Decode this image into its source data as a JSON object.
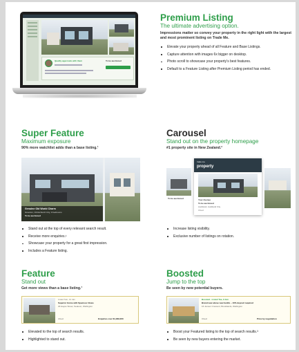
{
  "premium": {
    "title": "Premium Listing",
    "subtitle": "The ultimate advertising option.",
    "lead": "Impressions matter so convey your property in the right light with the largest and most prominent listing on Trade Me.",
    "bullets": [
      "Elevate your property ahead of all Feature and Base Listings.",
      "Capture attention with images 6x bigger on desktop.",
      "Photo scroll to showcase your property's best features.",
      "Default to a Feature Listing after Premium Listing period has ended."
    ],
    "screen": {
      "agent_text": "Quality approvals with them",
      "price_label": "To be auctioned"
    }
  },
  "super": {
    "title": "Super Feature",
    "subtitle": "Maximum exposure",
    "lead": "90% more watchlist adds than a base listing.¹",
    "photo_caption_title": "Genuine Old World Charm",
    "photo_caption_sub": "Greerton, Christchurch City, 3 bedrooms",
    "photo_caption_price": "To be auctioned",
    "bullets": [
      "Stand out at the top of every relevant search result.",
      "Receive more enquiries.¹",
      "Showcase your property for a great first impression.",
      "Includes a Feature listing."
    ]
  },
  "carousel": {
    "title": "Carousel",
    "subtitle": "Stand out on the property homepage",
    "lead": "#1 property site in New Zealand.²",
    "logo_small": "trade me",
    "logo_big": "property",
    "card_title": "Your Avenue",
    "card_price": "To be auctioned",
    "card_loc": "Auckland, Auckland City",
    "card_meta": "3 bed",
    "left_price": "To be auctioned",
    "bullets": [
      "Increase listing visibility.",
      "Exclusive number of listings on rotation."
    ]
  },
  "feature": {
    "title": "Feature",
    "subtitle": "Stand out",
    "lead": "Get more views than a base listing.¹",
    "card_head": "Listed Sun, 14 Jan",
    "card_title": "Superior Home with Spacious Views",
    "card_loc": "29 Hayes Street, Seatoun, Wellington",
    "card_meta": "4 bed",
    "card_price": "Enquiries over $1,299,000",
    "bullets": [
      "Elevated to the top of search results.",
      "Highlighted to stand out."
    ]
  },
  "boosted": {
    "title": "Boosted",
    "subtitle": "Jump to the top",
    "lead": "Be seen by new potential buyers.",
    "card_head": "Boosted · Listed Tue, 9 Jan",
    "card_title": "Brand new above new builds – 10% deposit required",
    "card_loc": "16 Jensen Crescent, Brooklands, Wellington",
    "card_meta": "3 bed",
    "card_price": "Price by negotiation",
    "bullets": [
      "Boost your Featured listing to the top of search results.³",
      "Be seen by new buyers entering the market."
    ]
  }
}
